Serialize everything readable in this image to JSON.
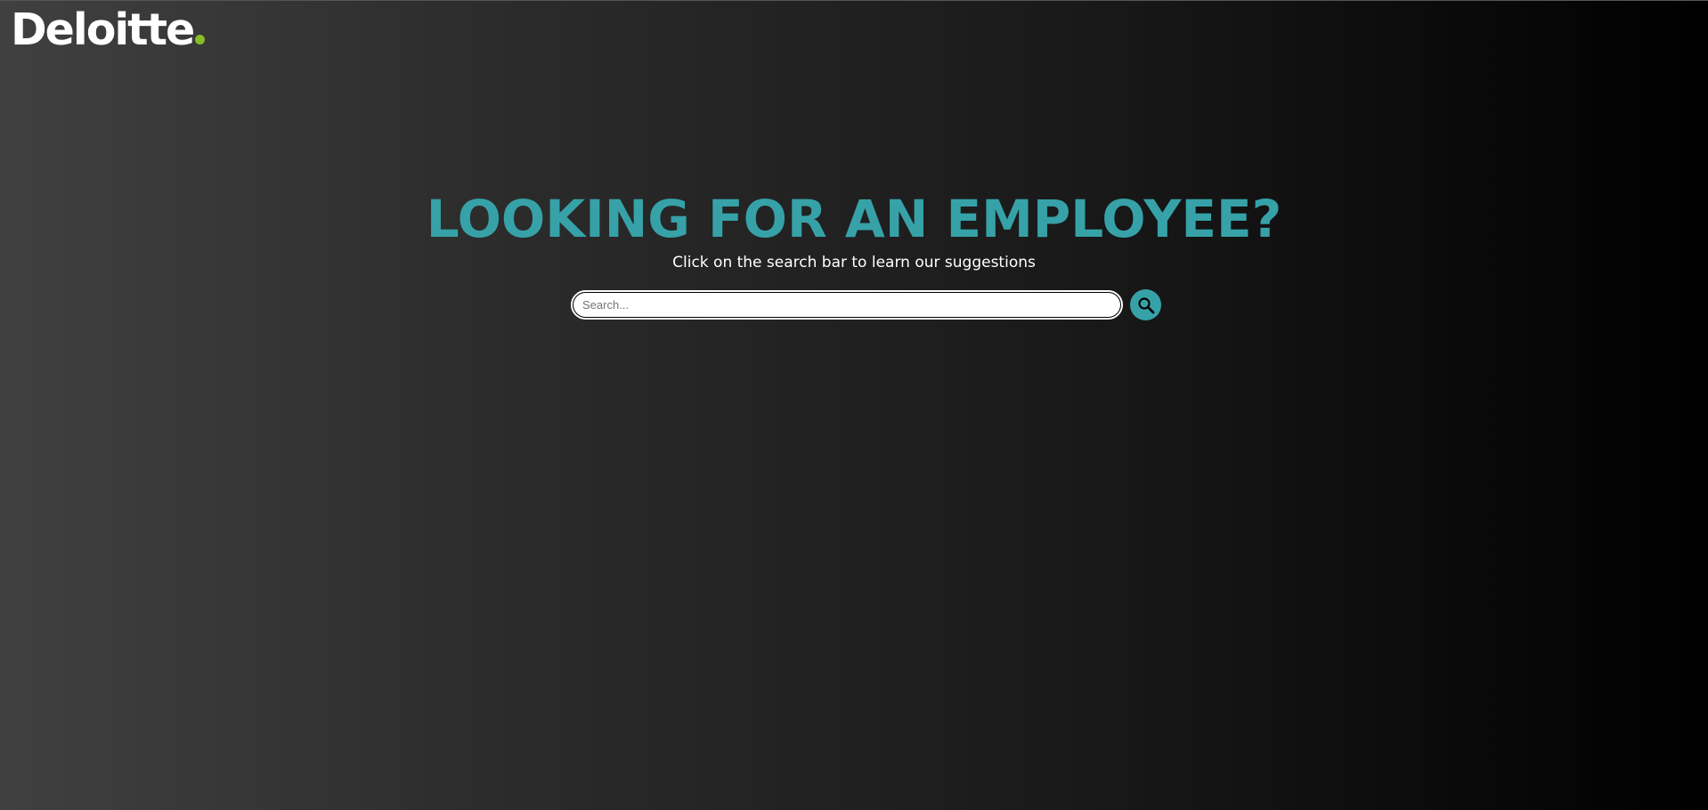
{
  "brand": {
    "logo_text": "Deloitte",
    "logo_dot_color": "#86bc25"
  },
  "hero": {
    "headline": "LOOKING FOR AN EMPLOYEE?",
    "subline": "Click on the search bar to learn our suggestions",
    "accent_color": "#36a2a8"
  },
  "search": {
    "placeholder": "Search...",
    "value": "",
    "button_icon": "search-icon"
  }
}
